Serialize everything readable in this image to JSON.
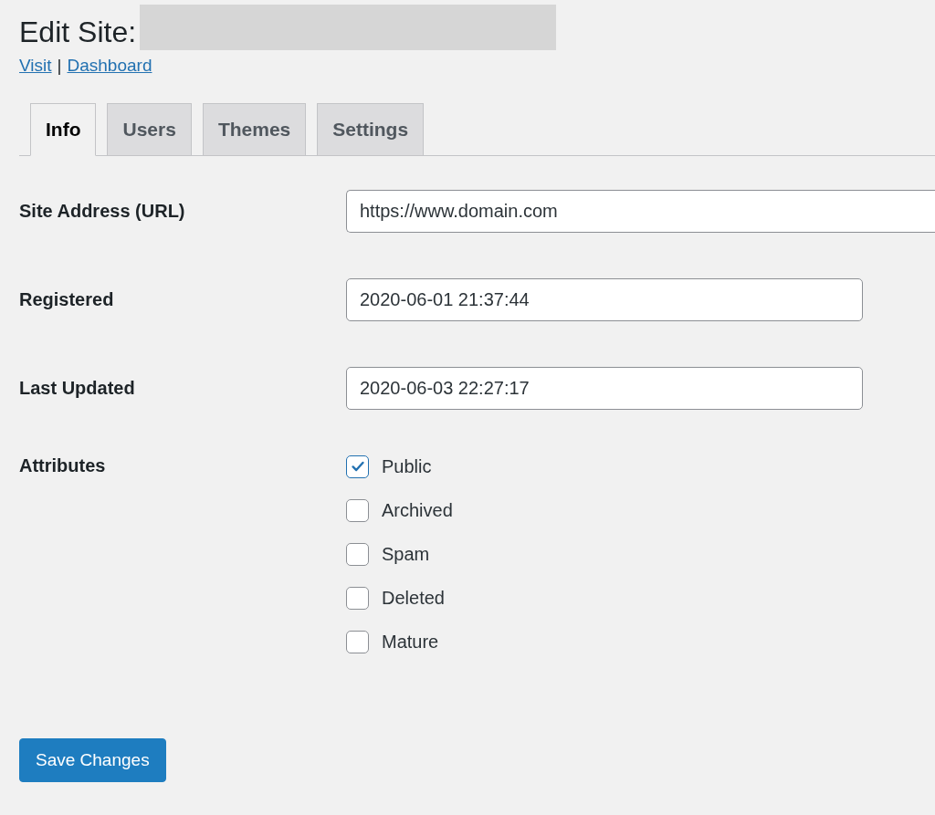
{
  "header": {
    "title": "Edit Site:",
    "links": [
      {
        "label": "Visit"
      },
      {
        "label": "Dashboard"
      }
    ],
    "separator": "|"
  },
  "tabs": [
    {
      "label": "Info",
      "selected": true
    },
    {
      "label": "Users",
      "selected": false
    },
    {
      "label": "Themes",
      "selected": false
    },
    {
      "label": "Settings",
      "selected": false
    }
  ],
  "fields": [
    {
      "label": "Site Address (URL)",
      "value": "https://www.domain.com",
      "wide": true
    },
    {
      "label": "Registered",
      "value": "2020-06-01 21:37:44",
      "wide": false
    },
    {
      "label": "Last Updated",
      "value": "2020-06-03 22:27:17",
      "wide": false
    }
  ],
  "attributes": {
    "label": "Attributes",
    "options": [
      {
        "label": "Public",
        "checked": true
      },
      {
        "label": "Archived",
        "checked": false
      },
      {
        "label": "Spam",
        "checked": false
      },
      {
        "label": "Deleted",
        "checked": false
      },
      {
        "label": "Mature",
        "checked": false
      }
    ]
  },
  "save_button": "Save Changes"
}
